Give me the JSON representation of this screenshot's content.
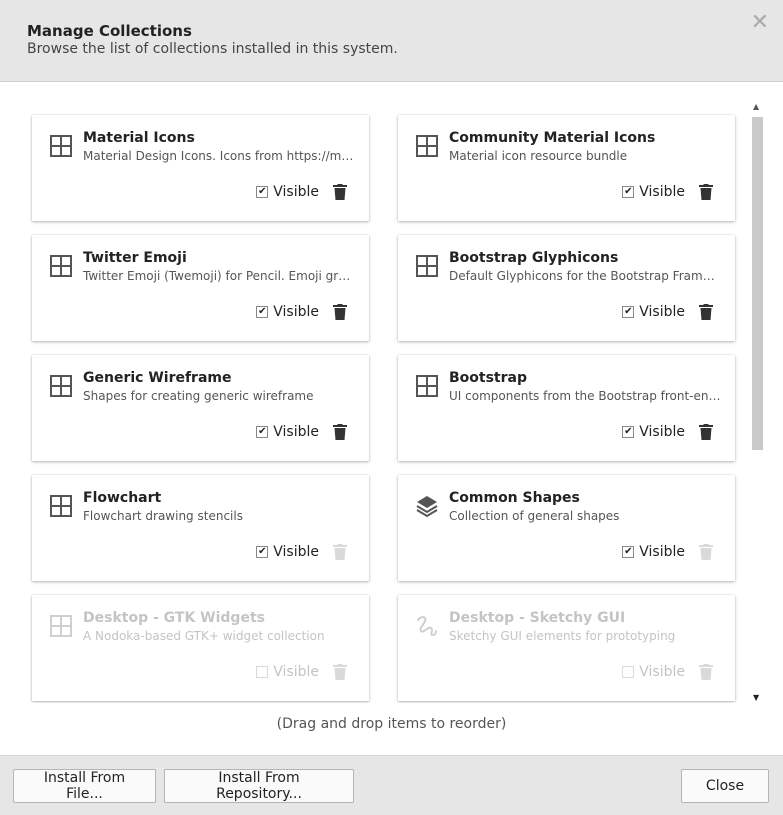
{
  "dialog": {
    "title": "Manage Collections",
    "subtitle": "Browse the list of collections installed in this system."
  },
  "collections": [
    {
      "name": "Material Icons",
      "description": "Material Design Icons. Icons from https://mat...",
      "visible_label": "Visible",
      "visible": true,
      "removable": true,
      "enabled": true,
      "icon": "grid-icon"
    },
    {
      "name": "Community Material Icons",
      "description": "Material icon resource bundle",
      "visible_label": "Visible",
      "visible": true,
      "removable": true,
      "enabled": true,
      "icon": "grid-icon"
    },
    {
      "name": "Twitter Emoji",
      "description": "Twitter Emoji (Twemoji) for Pencil.  Emoji gra...",
      "visible_label": "Visible",
      "visible": true,
      "removable": true,
      "enabled": true,
      "icon": "grid-icon"
    },
    {
      "name": "Bootstrap Glyphicons",
      "description": "Default Glyphicons for the Bootstrap Frame...",
      "visible_label": "Visible",
      "visible": true,
      "removable": true,
      "enabled": true,
      "icon": "grid-icon"
    },
    {
      "name": "Generic Wireframe",
      "description": "Shapes for creating generic wireframe",
      "visible_label": "Visible",
      "visible": true,
      "removable": true,
      "enabled": true,
      "icon": "grid-icon"
    },
    {
      "name": "Bootstrap",
      "description": "UI components from the Bootstrap front-end...",
      "visible_label": "Visible",
      "visible": true,
      "removable": true,
      "enabled": true,
      "icon": "grid-icon"
    },
    {
      "name": "Flowchart",
      "description": "Flowchart drawing stencils",
      "visible_label": "Visible",
      "visible": true,
      "removable": false,
      "enabled": true,
      "icon": "grid-icon"
    },
    {
      "name": "Common Shapes",
      "description": "Collection of general shapes",
      "visible_label": "Visible",
      "visible": true,
      "removable": false,
      "enabled": true,
      "icon": "layers-icon"
    },
    {
      "name": "Desktop - GTK Widgets",
      "description": "A Nodoka-based GTK+ widget collection",
      "visible_label": "Visible",
      "visible": false,
      "removable": false,
      "enabled": false,
      "icon": "grid-icon"
    },
    {
      "name": "Desktop - Sketchy GUI",
      "description": "Sketchy GUI elements for prototyping",
      "visible_label": "Visible",
      "visible": false,
      "removable": false,
      "enabled": false,
      "icon": "sketch-icon"
    }
  ],
  "hint": "(Drag and drop items to reorder)",
  "footer": {
    "install_file": "Install From File...",
    "install_repo": "Install From Repository...",
    "close": "Close"
  },
  "colors": {
    "header_bg": "#e6e6e6",
    "footer_bg": "#e6e6e6",
    "disabled_text": "#c4c4c4"
  }
}
